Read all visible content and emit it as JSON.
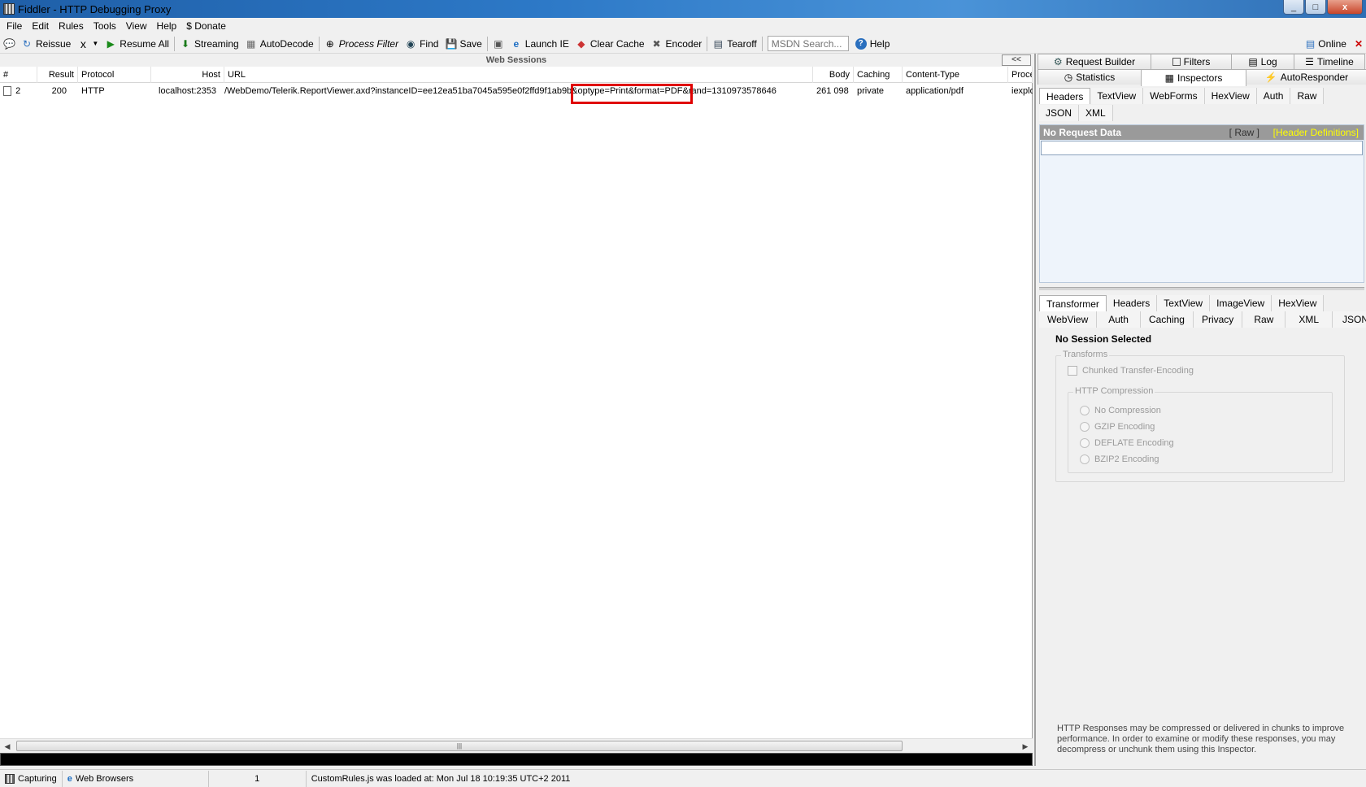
{
  "window": {
    "title": "Fiddler - HTTP Debugging Proxy",
    "minimize": "_",
    "maximize": "□",
    "close": "x"
  },
  "menu": [
    "File",
    "Edit",
    "Rules",
    "Tools",
    "View",
    "Help",
    "$ Donate"
  ],
  "toolbar": {
    "reissue": "Reissue",
    "remove": "x",
    "resume_all": "Resume All",
    "streaming": "Streaming",
    "autodecode": "AutoDecode",
    "process_filter": "Process Filter",
    "find": "Find",
    "save": "Save",
    "launch_ie": "Launch IE",
    "clear_cache": "Clear Cache",
    "encoder": "Encoder",
    "tearoff": "Tearoff",
    "search_placeholder": "MSDN Search...",
    "help": "Help",
    "online": "Online"
  },
  "sessions": {
    "header": "Web Sessions",
    "collapse": "<<",
    "columns": [
      "#",
      "Result",
      "Protocol",
      "Host",
      "URL",
      "Body",
      "Caching",
      "Content-Type",
      "Proce"
    ],
    "rows": [
      {
        "num": "2",
        "result": "200",
        "protocol": "HTTP",
        "host": "localhost:2353",
        "url": "/WebDemo/Telerik.ReportViewer.axd?instanceID=ee12ea51ba7045a595e0f2ffd9f1ab9b&optype=Print&format=PDF&rand=1310973578646",
        "body": "261 098",
        "caching": "private",
        "content_type": "application/pdf",
        "process": "iexplo"
      }
    ]
  },
  "right": {
    "tabs_row1": [
      "Request Builder",
      "Filters",
      "Log",
      "Timeline"
    ],
    "tabs_row2": [
      "Statistics",
      "Inspectors",
      "AutoResponder"
    ],
    "request_tabs_row1": [
      "Headers",
      "TextView",
      "WebForms",
      "HexView",
      "Auth",
      "Raw"
    ],
    "request_tabs_row2": [
      "JSON",
      "XML"
    ],
    "request_bar": {
      "title": "No Request Data",
      "raw": "[ Raw ]",
      "definitions": "[Header Definitions]"
    },
    "response_tabs_row1": [
      "Transformer",
      "Headers",
      "TextView",
      "ImageView",
      "HexView"
    ],
    "response_tabs_row2": [
      "WebView",
      "Auth",
      "Caching",
      "Privacy",
      "Raw",
      "XML",
      "JSON"
    ],
    "no_session": "No Session Selected",
    "transforms_legend": "Transforms",
    "chunked": "Chunked Transfer-Encoding",
    "compression_legend": "HTTP Compression",
    "compression_options": [
      "No Compression",
      "GZIP Encoding",
      "DEFLATE Encoding",
      "BZIP2 Encoding"
    ],
    "footer_note": "HTTP Responses may be compressed or delivered in chunks to improve performance.  In order to examine or modify these responses, you may decompress or unchunk them using this Inspector."
  },
  "status": {
    "capturing": "Capturing",
    "browsers": "Web Browsers",
    "count": "1",
    "message": "CustomRules.js was loaded at: Mon Jul 18 10:19:35 UTC+2 2011"
  },
  "colors": {
    "highlight": "#e00000",
    "titlebar": "#2d79c7",
    "definitions": "#ffff00"
  }
}
